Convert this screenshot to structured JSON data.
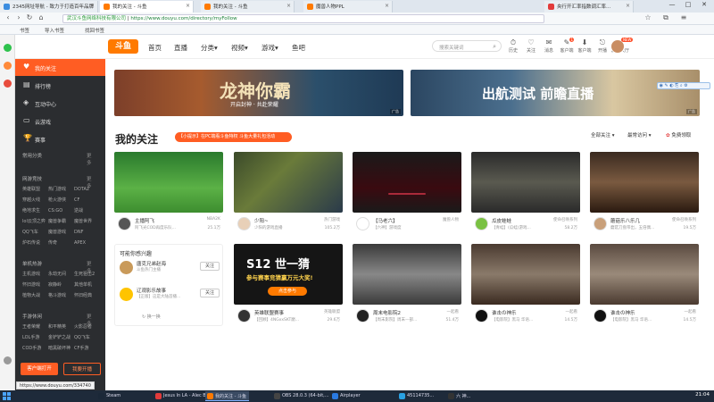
{
  "browser": {
    "tabs": [
      {
        "label": "2345网址导航 - 致力于打造百年品牌",
        "color": "#3b8de0"
      },
      {
        "label": "我的关注 - 斗鱼",
        "color": "#ff7a00",
        "active": true
      },
      {
        "label": "我的关注 - 斗鱼",
        "color": "#ff7a00"
      },
      {
        "label": "魔兽人物PPL",
        "color": "#ff7a00"
      },
      {
        "label": "央行开汇率指数调汇率...",
        "color": "#e23b3b"
      }
    ],
    "window_controls": [
      "—",
      "□",
      "✕"
    ],
    "security_label": "武汉斗鱼网络科技有限公司",
    "url": "https://www.douyu.com/directory/myFollow",
    "bookmarks": [
      "书签",
      "导入书签",
      "找回书签"
    ],
    "status_url": "https://www.douyu.com/334740"
  },
  "site": {
    "logo": "斗鱼",
    "nav": [
      "首页",
      "直播",
      "分类▾",
      "视频▾",
      "游戏▾",
      "鱼吧"
    ],
    "search_placeholder": "搜索关键词",
    "header_icons": [
      {
        "icon": "history-icon",
        "glyph": "⏱",
        "label": "历史"
      },
      {
        "icon": "follow-icon",
        "glyph": "♡",
        "label": "关注"
      },
      {
        "icon": "message-icon",
        "glyph": "✉",
        "label": "消息"
      },
      {
        "icon": "task-icon",
        "glyph": "✎",
        "label": "客户端",
        "badge": "1"
      },
      {
        "icon": "download-icon",
        "glyph": "⬇",
        "label": "客户端"
      },
      {
        "icon": "live-icon",
        "glyph": "⎋",
        "label": "开播"
      },
      {
        "icon": "game-icon",
        "glyph": "◎",
        "label": "超值大厅"
      }
    ],
    "avatar_badge": "NEW"
  },
  "sidebar": {
    "items": [
      {
        "label": "我的关注",
        "glyph": "♥",
        "active": true
      },
      {
        "label": "排行榜",
        "glyph": "▤"
      },
      {
        "label": "互动中心",
        "glyph": "◈"
      },
      {
        "label": "云游戏",
        "glyph": "▭"
      },
      {
        "label": "赛事",
        "glyph": "🏆"
      }
    ],
    "sections": [
      {
        "title": "常用分类",
        "more": "更多",
        "items": []
      },
      {
        "title": "网游竞技",
        "more": "更多",
        "items": [
          "英雄联盟",
          "热门游戏",
          "DOTA2",
          "穿越火线",
          "枪火游侠",
          "CF",
          "绝地求生",
          "CS:GO",
          "逆战",
          "lol云顶之弈",
          "魔兽争霸",
          "魔兽世界",
          "QQ飞车",
          "魔兽游戏",
          "DNF",
          "炉石传说",
          "传奇",
          "APEX"
        ]
      },
      {
        "title": "单机热游",
        "more": "更多",
        "items": [
          "主机游戏",
          "永劫无间",
          "生死狙击2",
          "怀旧游戏",
          "寂静岭",
          "其他单机",
          "植物大战",
          "格斗游戏",
          "怀旧经典"
        ]
      },
      {
        "title": "手游休闲",
        "more": "更多",
        "items": [
          "王者荣耀",
          "和平精英",
          "火影忍者",
          "LOL手游",
          "金铲铲之战",
          "QQ飞车",
          "COD手游",
          "暗黑破坏神",
          "CF手游"
        ]
      }
    ],
    "buttons": [
      "客户端打开",
      "我要开播"
    ]
  },
  "banners": [
    {
      "title": "龙神你霸",
      "sub": "开启封神 · 共赴荣耀",
      "tag": "广告"
    },
    {
      "title": "出航测试 前瞻直播",
      "sub": "",
      "tag": "广告"
    }
  ],
  "page": {
    "title": "我的关注",
    "notice": "【小提示】在PC端看斗鱼特权 斗鱼大量礼包活动",
    "sort_options": [
      "全部关注 ▾",
      "最常访问 ▾",
      "免费领取"
    ]
  },
  "cards": [
    {
      "name": "主播阿飞",
      "category": "NBA2K",
      "title": "阿飞光COD再度乐队...",
      "heat": "25.1万",
      "thumb": "linear-gradient(180deg,#2a7a2d,#5bb146 60%,#3d8d2f)",
      "avatar": "#555"
    },
    {
      "name": "少阳~",
      "category": "热门游戏",
      "title": "少阳的游戏直播",
      "heat": "105.2万",
      "thumb": "linear-gradient(135deg,#3b4a2a,#6a7b3a 40%,#2a3a4a)",
      "avatar": "#e8d0b8"
    },
    {
      "name": "【马老六】",
      "category": "魔兽人物",
      "title": "【六神】游戏度",
      "heat": "",
      "thumb": "linear-gradient(180deg,#1a1a1a,#3a0a10 60%,#1a1a1a)",
      "avatar": "#fff"
    },
    {
      "name": "瓜皮蛙蛙",
      "category": "使命召唤系列",
      "title": "【青蛙】(瓜蛙)游戏...",
      "heat": "58.2万",
      "thumb": "linear-gradient(180deg,#2a2a2a,#5a5a50 50%,#2a2a2a)",
      "avatar": "#7ac143"
    },
    {
      "name": "蘑菇乐八乐几",
      "category": "使命召唤系列",
      "title": "蘑菇刀盘带出，五倍偶...",
      "heat": "19.5万",
      "thumb": "linear-gradient(180deg,#3a2a20,#7a5a40 50%,#2a1a10)",
      "avatar": "#c9a07a"
    },
    {
      "name": "英雄联盟赛事",
      "category": "英雄联盟",
      "title": "【回顾】4NGxxSKT巅...",
      "heat": "29.6万",
      "thumb": "linear-gradient(180deg,#1a1a1a,#1a1a1a)",
      "avatar": "#333"
    },
    {
      "name": "周末电影院2",
      "category": "一起看",
      "title": "【周末影院】周末—部...",
      "heat": "51.4万",
      "thumb": "linear-gradient(180deg,#3a3a3a,#888 50%,#3a3a3a)",
      "avatar": "#222"
    },
    {
      "name": "谁击の神乐",
      "category": "一起看",
      "title": "【电影院】黑马 华语...",
      "heat": "14.5万",
      "thumb": "linear-gradient(180deg,#4a3a30,#8a7a6a 50%,#3a2a20)",
      "avatar": "#111"
    },
    {
      "name": "谁击の神乐",
      "category": "一起看",
      "title": "【电影院】黑马 华语...",
      "heat": "14.5万",
      "thumb": "linear-gradient(180deg,#5a4a40,#9a8a7a 50%,#4a3a30)",
      "avatar": "#111"
    }
  ],
  "may_interest": {
    "title": "可能你感兴趣",
    "items": [
      {
        "name": "唐克兄弟赵海",
        "desc": "斗鱼热门主播",
        "follow": "关注",
        "color": "#c99a5a"
      },
      {
        "name": "辽观影乐故事",
        "desc": "【正版】这是大陆首播...",
        "follow": "关注",
        "color": "#ffc400"
      }
    ],
    "refresh": "换一换"
  },
  "s12": {
    "title": "S12 世一猜",
    "sub": "参与赛事竞猜赢万元大奖!",
    "btn": "点击参与"
  },
  "taskbar": {
    "items": [
      {
        "label": "",
        "color": "#fff"
      },
      {
        "label": "Steam",
        "color": "#1b2838"
      },
      {
        "label": "Jesus In LA - Alec B.",
        "color": "#e23b3b"
      },
      {
        "label": "我的关注 - 斗鱼",
        "color": "#ff7a00",
        "selected": true
      },
      {
        "label": "OBS 28.0.3 (64-bit,...",
        "color": "#444"
      },
      {
        "label": "Airplayer",
        "color": "#2a7ae2"
      },
      {
        "label": "45114735...",
        "color": "#2aa1e2"
      },
      {
        "label": "六 神...",
        "color": "#333"
      }
    ],
    "clock": "21:04"
  }
}
